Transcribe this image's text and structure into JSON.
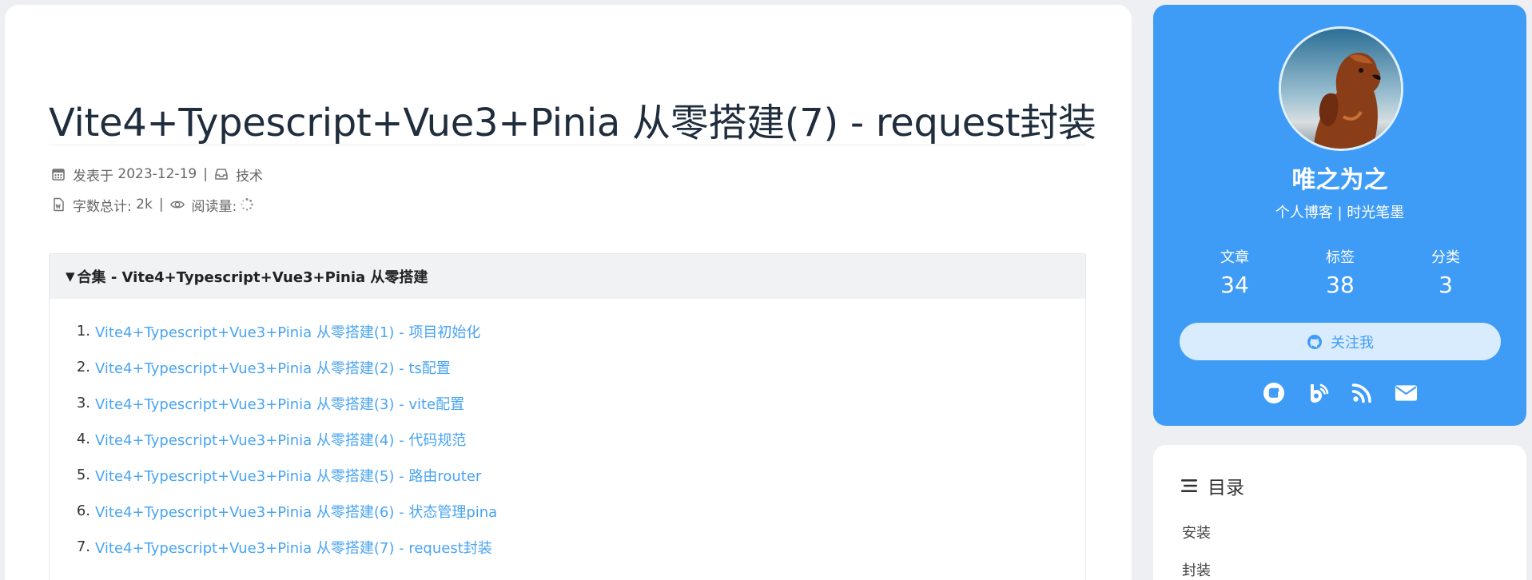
{
  "post": {
    "title": "Vite4+Typescript+Vue3+Pinia 从零搭建(7) - request封装",
    "meta": {
      "posted_label": "发表于",
      "posted_date": "2023-12-19",
      "category": "技术",
      "wordcount_label": "字数总计:",
      "wordcount": "2k",
      "views_label": "阅读量:"
    },
    "collection": {
      "toggle_glyph": "▼",
      "title": "合集 - Vite4+Typescript+Vue3+Pinia 从零搭建",
      "items": [
        {
          "num": "1.",
          "text": "Vite4+Typescript+Vue3+Pinia 从零搭建(1) - 项目初始化"
        },
        {
          "num": "2.",
          "text": "Vite4+Typescript+Vue3+Pinia 从零搭建(2) - ts配置"
        },
        {
          "num": "3.",
          "text": "Vite4+Typescript+Vue3+Pinia 从零搭建(3) - vite配置"
        },
        {
          "num": "4.",
          "text": "Vite4+Typescript+Vue3+Pinia 从零搭建(4) - 代码规范"
        },
        {
          "num": "5.",
          "text": "Vite4+Typescript+Vue3+Pinia 从零搭建(5) - 路由router"
        },
        {
          "num": "6.",
          "text": "Vite4+Typescript+Vue3+Pinia 从零搭建(6) - 状态管理pina"
        },
        {
          "num": "7.",
          "text": "Vite4+Typescript+Vue3+Pinia 从零搭建(7) - request封装"
        }
      ]
    }
  },
  "profile": {
    "author": "唯之为之",
    "slogan": "个人博客 | 时光笔墨",
    "stats": [
      {
        "label": "文章",
        "value": "34"
      },
      {
        "label": "标签",
        "value": "38"
      },
      {
        "label": "分类",
        "value": "3"
      }
    ],
    "follow_label": "关注我",
    "social_icons": [
      "gitee-icon",
      "blog-icon",
      "rss-icon",
      "mail-icon"
    ]
  },
  "toc": {
    "title": "目录",
    "items": [
      "安装",
      "封装"
    ]
  },
  "colors": {
    "accent": "#3f9cf6",
    "link": "#49a4f2",
    "follow_bg": "#d9ecfe"
  }
}
